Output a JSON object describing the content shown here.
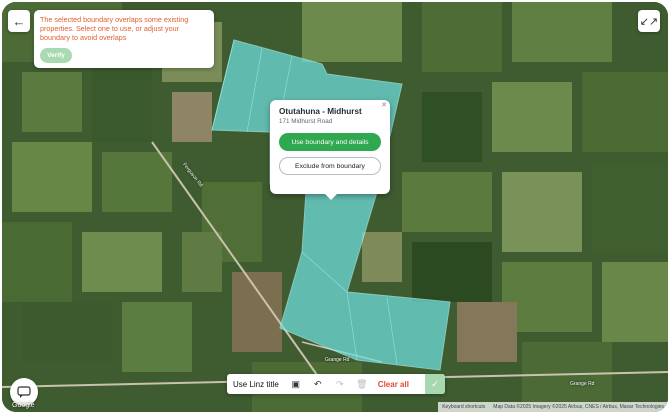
{
  "colors": {
    "boundary_fill": "#6fe0e0",
    "warning_text": "#e0602f",
    "primary_green": "#2fa84f",
    "verify_disabled": "#a9d9b1",
    "clear_red": "#e24b34"
  },
  "warning": {
    "message": "The selected boundary overlaps some existing properties. Select one to use, or adjust your boundary to avoid overlaps",
    "verify_label": "Verify"
  },
  "popup": {
    "title": "Otutahuna - Midhurst",
    "address": "171 Midhurst Road",
    "use_boundary_label": "Use boundary and details",
    "exclude_label": "Exclude from boundary",
    "close_icon": "close-icon"
  },
  "toolbar": {
    "linz_label": "Use Linz title",
    "clear_label": "Clear all",
    "icons": [
      "polygon-edit-icon",
      "undo-icon",
      "redo-icon",
      "trash-icon",
      "check-icon"
    ]
  },
  "map": {
    "roads": [
      "Ferguson Rd",
      "Grange Rd",
      "Grange Rd"
    ],
    "google_logo": "Google",
    "attribution": [
      "Keyboard shortcuts",
      "Map Data ©2025 Imagery ©2025 Airbus, CNES / Airbus, Maxar Technologies"
    ]
  },
  "controls": {
    "back_icon": "arrow-left-icon",
    "collapse_icon": "collapse-icon",
    "chat_icon": "chat-icon"
  }
}
